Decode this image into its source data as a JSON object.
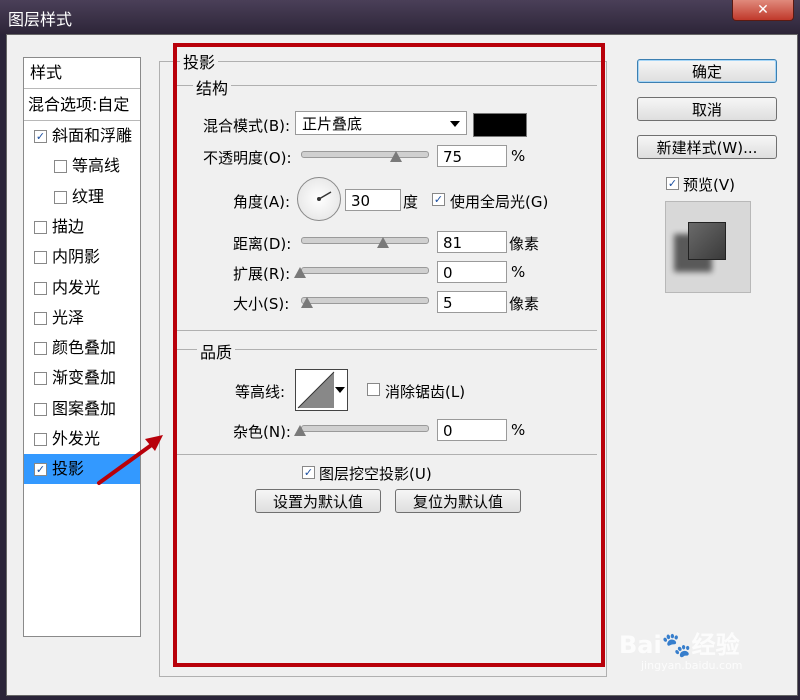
{
  "window": {
    "title": "图层样式",
    "close_glyph": "✕"
  },
  "style_list": {
    "header": "样式",
    "blend_options": "混合选项:自定",
    "items": [
      {
        "label": "斜面和浮雕",
        "checked": true
      },
      {
        "label": "等高线",
        "checked": false
      },
      {
        "label": "纹理",
        "checked": false
      },
      {
        "label": "描边",
        "checked": false
      },
      {
        "label": "内阴影",
        "checked": false
      },
      {
        "label": "内发光",
        "checked": false
      },
      {
        "label": "光泽",
        "checked": false
      },
      {
        "label": "颜色叠加",
        "checked": false
      },
      {
        "label": "渐变叠加",
        "checked": false
      },
      {
        "label": "图案叠加",
        "checked": false
      },
      {
        "label": "外发光",
        "checked": false
      },
      {
        "label": "投影",
        "checked": true
      }
    ]
  },
  "panel": {
    "title": "投影",
    "structure": {
      "title": "结构",
      "blend_mode_label": "混合模式(B):",
      "blend_mode_value": "正片叠底",
      "blend_color": "#000000",
      "opacity_label": "不透明度(O):",
      "opacity_value": "75",
      "opacity_unit": "%",
      "angle_label": "角度(A):",
      "angle_value": "30",
      "angle_unit": "度",
      "global_light_label": "使用全局光(G)",
      "global_light_checked": true,
      "distance_label": "距离(D):",
      "distance_value": "81",
      "distance_unit": "像素",
      "spread_label": "扩展(R):",
      "spread_value": "0",
      "spread_unit": "%",
      "size_label": "大小(S):",
      "size_value": "5",
      "size_unit": "像素"
    },
    "quality": {
      "title": "品质",
      "contour_label": "等高线:",
      "antialias_label": "消除锯齿(L)",
      "antialias_checked": false,
      "noise_label": "杂色(N):",
      "noise_value": "0",
      "noise_unit": "%"
    },
    "knockout_label": "图层挖空投影(U)",
    "knockout_checked": true,
    "set_default_label": "设置为默认值",
    "reset_default_label": "复位为默认值"
  },
  "buttons": {
    "ok": "确定",
    "cancel": "取消",
    "new_style": "新建样式(W)...",
    "preview_label": "预览(V)",
    "preview_checked": true
  },
  "watermark": {
    "brand": "Bai",
    "brand2": "经验",
    "url": "jingyan.baidu.com"
  },
  "colors": {
    "highlight": "#3399ff",
    "annotation_red": "#b8000a",
    "check": "#1c4fa0"
  }
}
